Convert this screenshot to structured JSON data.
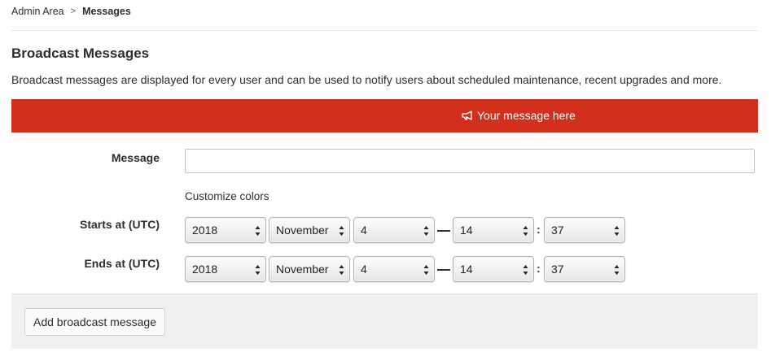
{
  "breadcrumb": {
    "parent": "Admin Area",
    "separator": ">",
    "current": "Messages"
  },
  "page": {
    "title": "Broadcast Messages",
    "description": "Broadcast messages are displayed for every user and can be used to notify users about scheduled maintenance, recent upgrades and more."
  },
  "preview": {
    "icon": "bullhorn-icon",
    "text": "Your message here",
    "color": "#d22f1c"
  },
  "form": {
    "message_label": "Message",
    "message_value": "",
    "customize_colors": "Customize colors",
    "starts_label": "Starts at (UTC)",
    "ends_label": "Ends at (UTC)",
    "starts": {
      "year": "2018",
      "month": "November",
      "day": "4",
      "hour": "14",
      "minute": "37"
    },
    "ends": {
      "year": "2018",
      "month": "November",
      "day": "4",
      "hour": "14",
      "minute": "37"
    },
    "time_separator": ":"
  },
  "footer": {
    "add_button": "Add broadcast message"
  }
}
